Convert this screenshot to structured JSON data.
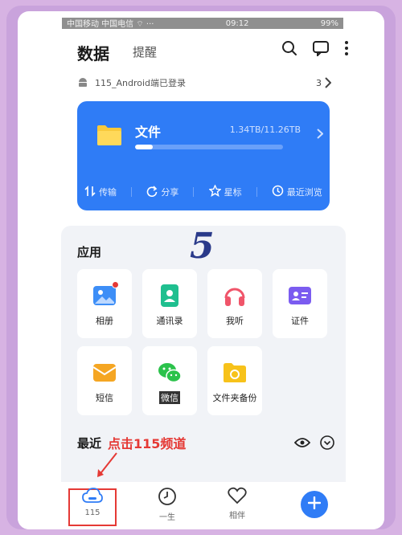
{
  "status": {
    "carrier": "中国移动 中国电信 ⌔ ···",
    "time": "09:12",
    "battery": "99%"
  },
  "header": {
    "title": "数据",
    "tab": "提醒"
  },
  "login": {
    "text": "115_Android端已登录",
    "count": "3"
  },
  "file_card": {
    "title": "文件",
    "size": "1.34TB/11.26TB",
    "progress": 0.12,
    "actions": [
      {
        "label": "传输",
        "icon": "transfer-icon"
      },
      {
        "label": "分享",
        "icon": "share-icon"
      },
      {
        "label": "星标",
        "icon": "star-icon"
      },
      {
        "label": "最近浏览",
        "icon": "history-icon"
      }
    ]
  },
  "apps": {
    "title": "应用",
    "step_number": "5",
    "items": [
      {
        "label": "相册",
        "icon": "photo-icon",
        "color": "#3d8ef7"
      },
      {
        "label": "通讯录",
        "icon": "contacts-icon",
        "color": "#1fbf8f"
      },
      {
        "label": "我听",
        "icon": "headphones-icon",
        "color": "#f0556a"
      },
      {
        "label": "证件",
        "icon": "id-card-icon",
        "color": "#7b5cf0"
      },
      {
        "label": "短信",
        "icon": "message-icon",
        "color": "#f5a623"
      },
      {
        "label": "微信",
        "icon": "wechat-icon",
        "color": "#2bc24b"
      },
      {
        "label": "文件夹备份",
        "icon": "folder-backup-icon",
        "color": "#f7c21a"
      }
    ]
  },
  "recent": {
    "title": "最近",
    "annotation": "点击115频道"
  },
  "bottom_nav": {
    "items": [
      {
        "label": "115",
        "icon": "cloud-icon"
      },
      {
        "label": "一生",
        "icon": "clock-icon"
      },
      {
        "label": "相伴",
        "icon": "heart-icon"
      }
    ],
    "fab_icon": "plus-icon"
  },
  "colors": {
    "accent": "#2f7cf6",
    "annotation": "#e53935"
  }
}
